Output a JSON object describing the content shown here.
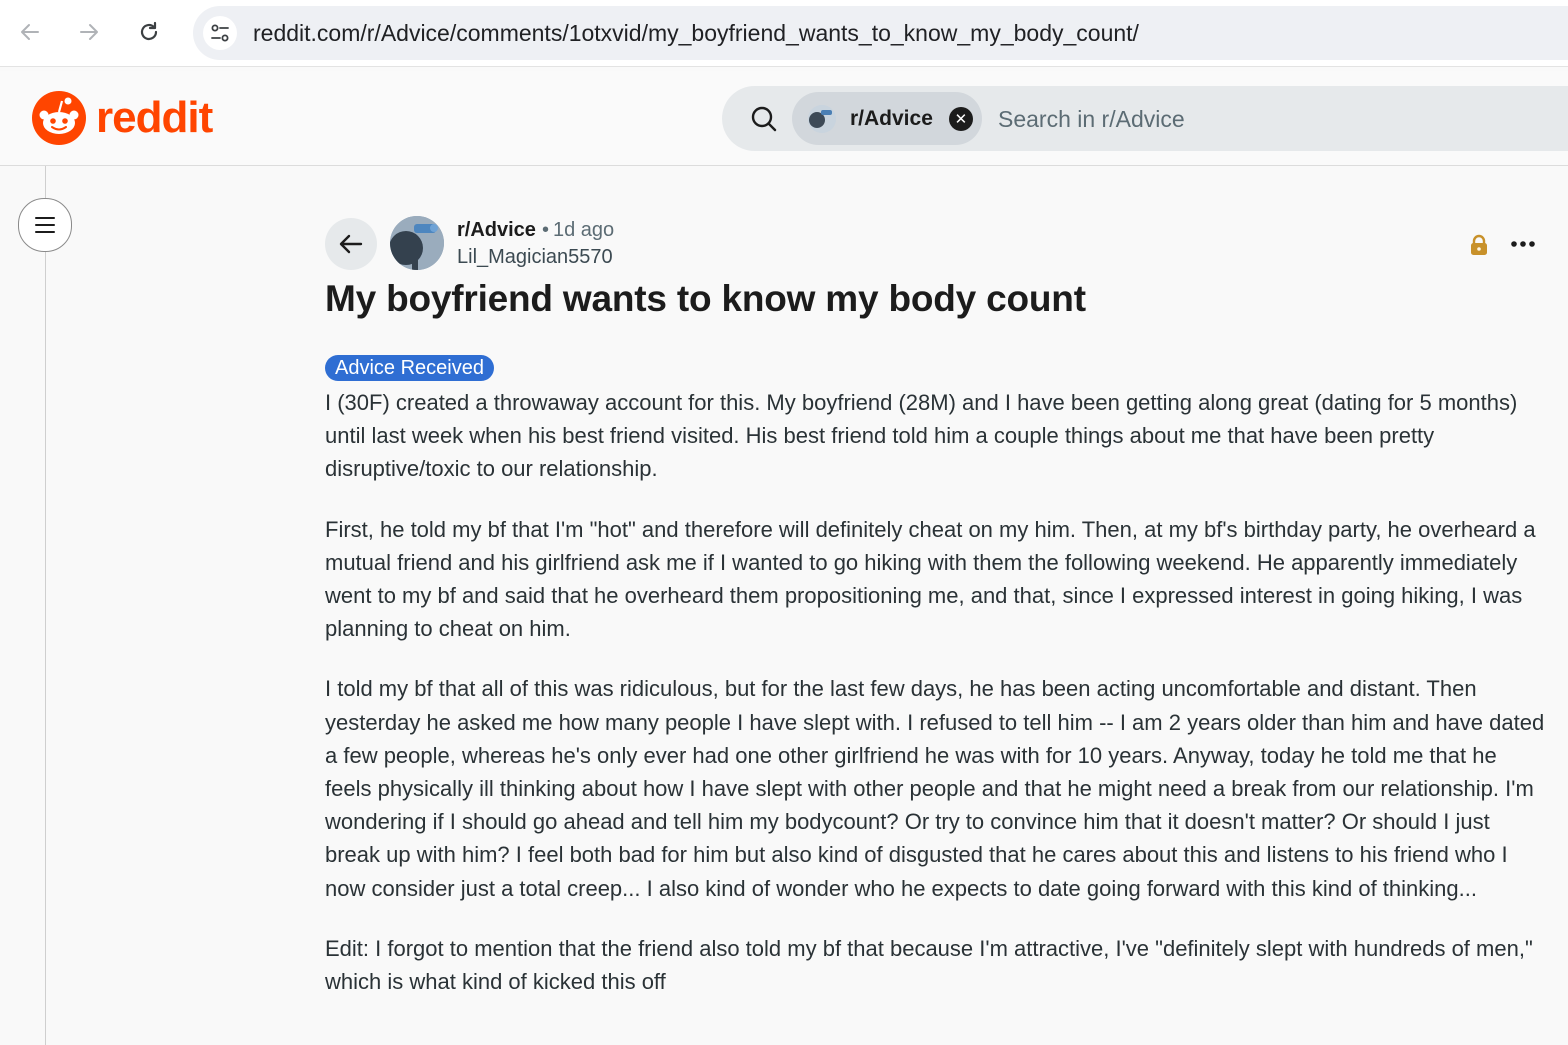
{
  "browser": {
    "url": "reddit.com/r/Advice/comments/1otxvid/my_boyfriend_wants_to_know_my_body_count/"
  },
  "header": {
    "logo_text": "reddit",
    "search": {
      "scope_label": "r/Advice",
      "placeholder": "Search in r/Advice"
    }
  },
  "post": {
    "subreddit": "r/Advice",
    "separator": "•",
    "time": "1d ago",
    "author": "Lil_Magician5570",
    "title": "My boyfriend wants to know my body count",
    "flair": "Advice Received",
    "paragraphs": [
      "I (30F) created a throwaway account for this. My boyfriend (28M) and I have been getting along great (dating for 5 months) until last week when his best friend visited. His best friend told him a couple things about me that have been pretty disruptive/toxic to our relationship.",
      "First, he told my bf that I'm \"hot\" and therefore will definitely cheat on my him. Then, at my bf's birthday party, he overheard a mutual friend and his girlfriend ask me if I wanted to go hiking with them the following weekend. He apparently immediately went to my bf and said that he overheard them propositioning me, and that, since I expressed interest in going hiking, I was planning to cheat on him.",
      "I told my bf that all of this was ridiculous, but for the last few days, he has been acting uncomfortable and distant. Then yesterday he asked me how many people I have slept with. I refused to tell him -- I am 2 years older than him and have dated a few people, whereas he's only ever had one other girlfriend he was with for 10 years. Anyway, today he told me that he feels physically ill thinking about how I have slept with other people and that he might need a break from our relationship. I'm wondering if I should go ahead and tell him my bodycount? Or try to convince him that it doesn't matter? Or should I just break up with him? I feel both bad for him but also kind of disgusted that he cares about this and listens to his friend who I now consider just a total creep... I also kind of wonder who he expects to date going forward with this kind of thinking...",
      "Edit: I forgot to mention that the friend also told my bf that because I'm attractive, I've \"definitely slept with hundreds of men,\" which is what kind of kicked this off"
    ]
  },
  "icons": {
    "back": "arrow-left-icon",
    "forward": "arrow-right-icon",
    "reload": "reload-icon",
    "site_info": "tune-icon",
    "search": "search-icon",
    "menu": "hamburger-icon",
    "lock": "lock-icon",
    "more": "ellipsis-icon"
  },
  "colors": {
    "brand": "#ff4500",
    "flair_bg": "#2f6ed3",
    "lock": "#c8912a"
  }
}
